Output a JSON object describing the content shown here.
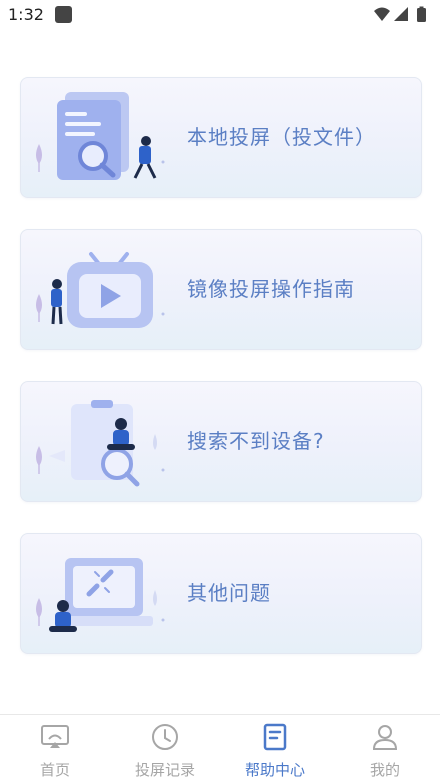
{
  "status_bar": {
    "time": "1:32",
    "icons": [
      "app-notification-icon",
      "wifi-icon",
      "cellular-signal-icon",
      "battery-icon"
    ]
  },
  "help_cards": [
    {
      "label": "本地投屏（投文件）",
      "illustration": "document-search-illustration"
    },
    {
      "label": "镜像投屏操作指南",
      "illustration": "tv-play-illustration"
    },
    {
      "label": "搜索不到设备?",
      "illustration": "clipboard-search-illustration"
    },
    {
      "label": "其他问题",
      "illustration": "broken-link-laptop-illustration"
    }
  ],
  "tab_bar": {
    "tabs": [
      {
        "label": "首页",
        "icon": "cast-screen-icon",
        "active": false
      },
      {
        "label": "投屏记录",
        "icon": "clock-icon",
        "active": false
      },
      {
        "label": "帮助中心",
        "icon": "document-icon",
        "active": true
      },
      {
        "label": "我的",
        "icon": "person-icon",
        "active": false
      }
    ]
  },
  "colors": {
    "accent": "#4b79c9",
    "card_text": "#5b7fc4",
    "tab_inactive": "#a6a6a6",
    "illustration_primary": "#8fa3e6"
  }
}
